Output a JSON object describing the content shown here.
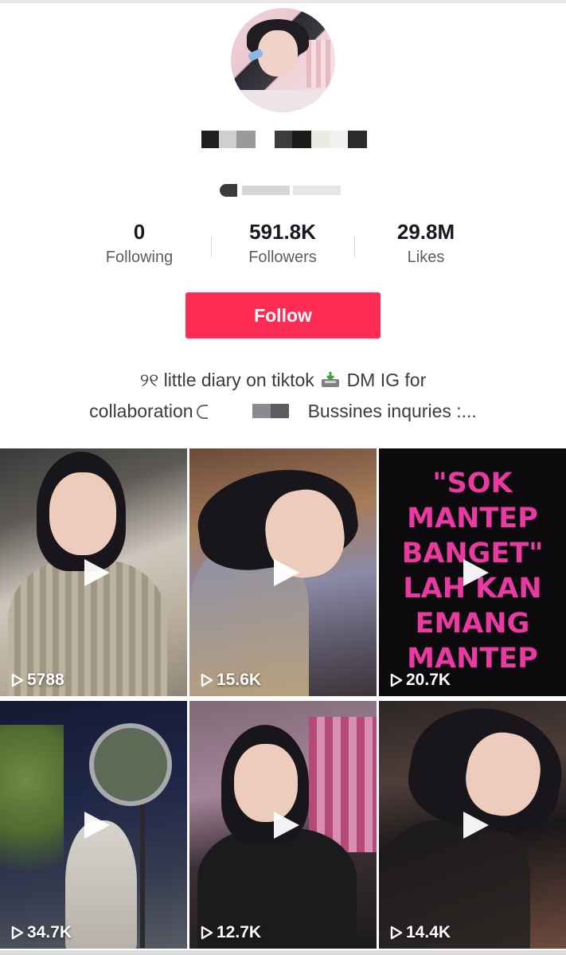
{
  "profile": {
    "avatar_label": "profile-photo",
    "stats": [
      {
        "value": "0",
        "label": "Following"
      },
      {
        "value": "591.8K",
        "label": "Followers"
      },
      {
        "value": "29.8M",
        "label": "Likes"
      }
    ],
    "follow_label": "Follow",
    "bio": {
      "line1_a": "୨୧ little diary on tiktok",
      "line1_b": "DM IG for",
      "line2_a": "collaboration",
      "line2_b": "Bussines inquries :..."
    }
  },
  "videos": [
    {
      "views": "5788"
    },
    {
      "views": "15.6K"
    },
    {
      "views": "20.7K",
      "overlay_text": [
        "\"SOK",
        "MANTEP",
        "BANGET\"",
        "LAH KAN",
        "EMANG",
        "MANTEP"
      ]
    },
    {
      "views": "34.7K"
    },
    {
      "views": "12.7K"
    },
    {
      "views": "14.4K"
    }
  ],
  "colors": {
    "follow_button": "#fe2c55",
    "overlay_text": "#e83aa0",
    "text_primary": "#161823",
    "text_secondary": "#5c5c63"
  },
  "icons": {
    "play": "play-icon",
    "views": "play-outline-icon",
    "inbox": "inbox-tray-icon"
  }
}
